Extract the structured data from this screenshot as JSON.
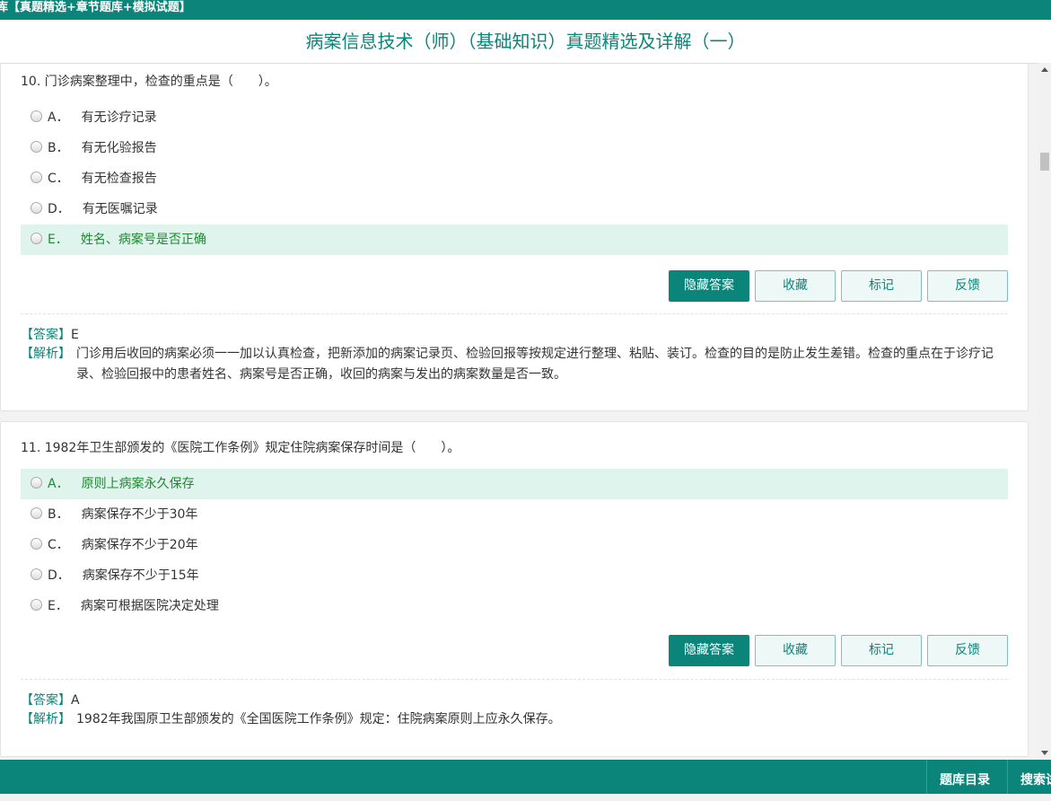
{
  "topbar": {
    "text": "库【真题精选+章节题库+模拟试题】"
  },
  "header": {
    "title": "病案信息技术（师）（基础知识）真题精选及详解（一）"
  },
  "questions": [
    {
      "text": "10. 门诊病案整理中，检查的重点是（　　）。",
      "options": [
        {
          "letter": "A．",
          "label": "有无诊疗记录"
        },
        {
          "letter": "B．",
          "label": "有无化验报告"
        },
        {
          "letter": "C．",
          "label": "有无检查报告"
        },
        {
          "letter": "D．",
          "label": "有无医嘱记录"
        },
        {
          "letter": "E．",
          "label": "姓名、病案号是否正确"
        }
      ],
      "buttons": {
        "hide": "隐藏答案",
        "fav": "收藏",
        "mark": "标记",
        "feedback": "反馈"
      },
      "answer_tag": "【答案】",
      "answer": "E",
      "explain_tag": "【解析】",
      "explain": "门诊用后收回的病案必须一一加以认真检查，把新添加的病案记录页、检验回报等按规定进行整理、粘贴、装订。检查的目的是防止发生差错。检查的重点在于诊疗记录、检验回报中的患者姓名、病案号是否正确，收回的病案与发出的病案数量是否一致。"
    },
    {
      "text": "11. 1982年卫生部颁发的《医院工作条例》规定住院病案保存时间是（　　）。",
      "options": [
        {
          "letter": "A．",
          "label": "原则上病案永久保存"
        },
        {
          "letter": "B．",
          "label": "病案保存不少于30年"
        },
        {
          "letter": "C．",
          "label": "病案保存不少于20年"
        },
        {
          "letter": "D．",
          "label": "病案保存不少于15年"
        },
        {
          "letter": "E．",
          "label": "病案可根据医院决定处理"
        }
      ],
      "buttons": {
        "hide": "隐藏答案",
        "fav": "收藏",
        "mark": "标记",
        "feedback": "反馈"
      },
      "answer_tag": "【答案】",
      "answer": "A",
      "explain_tag": "【解析】",
      "explain": "1982年我国原卫生部颁发的《全国医院工作条例》规定：住院病案原则上应永久保存。"
    }
  ],
  "bottombar": {
    "catalog": "题库目录",
    "search": "搜索试题"
  }
}
